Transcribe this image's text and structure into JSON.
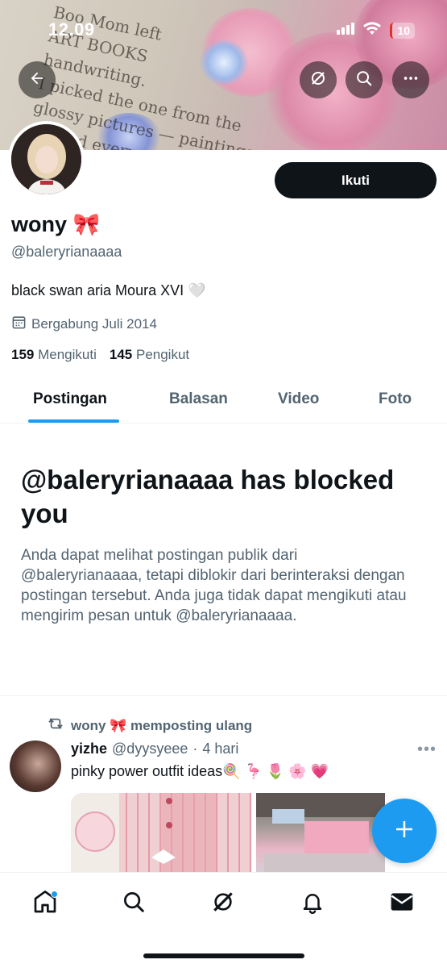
{
  "status_bar": {
    "time": "12.09",
    "battery": "10"
  },
  "banner": {
    "page_lines": [
      "Boo Mom left",
      "ART BOOKS",
      "handwriting.",
      "I picked the one from the",
      "glossy pictures — paintings, sculpt",
      "tripped every single pict"
    ]
  },
  "profile": {
    "display_name": "wony 🎀",
    "handle": "@baleryrianaaaa",
    "bio": "black swan aria Moura XVI 🤍",
    "joined": "Bergabung Juli 2014",
    "following_count": "159",
    "following_label": "Mengikuti",
    "followers_count": "145",
    "followers_label": "Pengikut",
    "follow_button": "Ikuti"
  },
  "tabs": [
    {
      "label": "Postingan"
    },
    {
      "label": "Balasan"
    },
    {
      "label": "Video"
    },
    {
      "label": "Foto"
    }
  ],
  "blocked": {
    "title": "@baleryrianaaaa has blocked you",
    "description": "Anda dapat melihat postingan publik dari @baleryrianaaaa, tetapi diblokir dari berinteraksi dengan postingan tersebut. Anda juga tidak dapat mengikuti atau mengirim pesan untuk @baleryrianaaaa."
  },
  "post": {
    "repost_label": "wony 🎀 memposting ulang",
    "author_name": "yizhe",
    "author_handle": "@dyysyeee",
    "time": "4 hari",
    "separator": "·",
    "text": "pinky power outfit ideas🍭 🦩 🌷 🌸 💗",
    "more": "•••"
  },
  "icons": {
    "back": "back-arrow-icon",
    "grok": "grok-icon",
    "search": "search-icon",
    "more": "more-icon",
    "calendar": "calendar-icon",
    "repost": "repost-icon",
    "compose": "plus-icon",
    "nav": [
      "home-icon",
      "search-icon",
      "grok-icon",
      "bell-icon",
      "mail-icon"
    ]
  },
  "colors": {
    "accent": "#1d9bf0",
    "text_primary": "#0f1419",
    "text_secondary": "#536471"
  }
}
